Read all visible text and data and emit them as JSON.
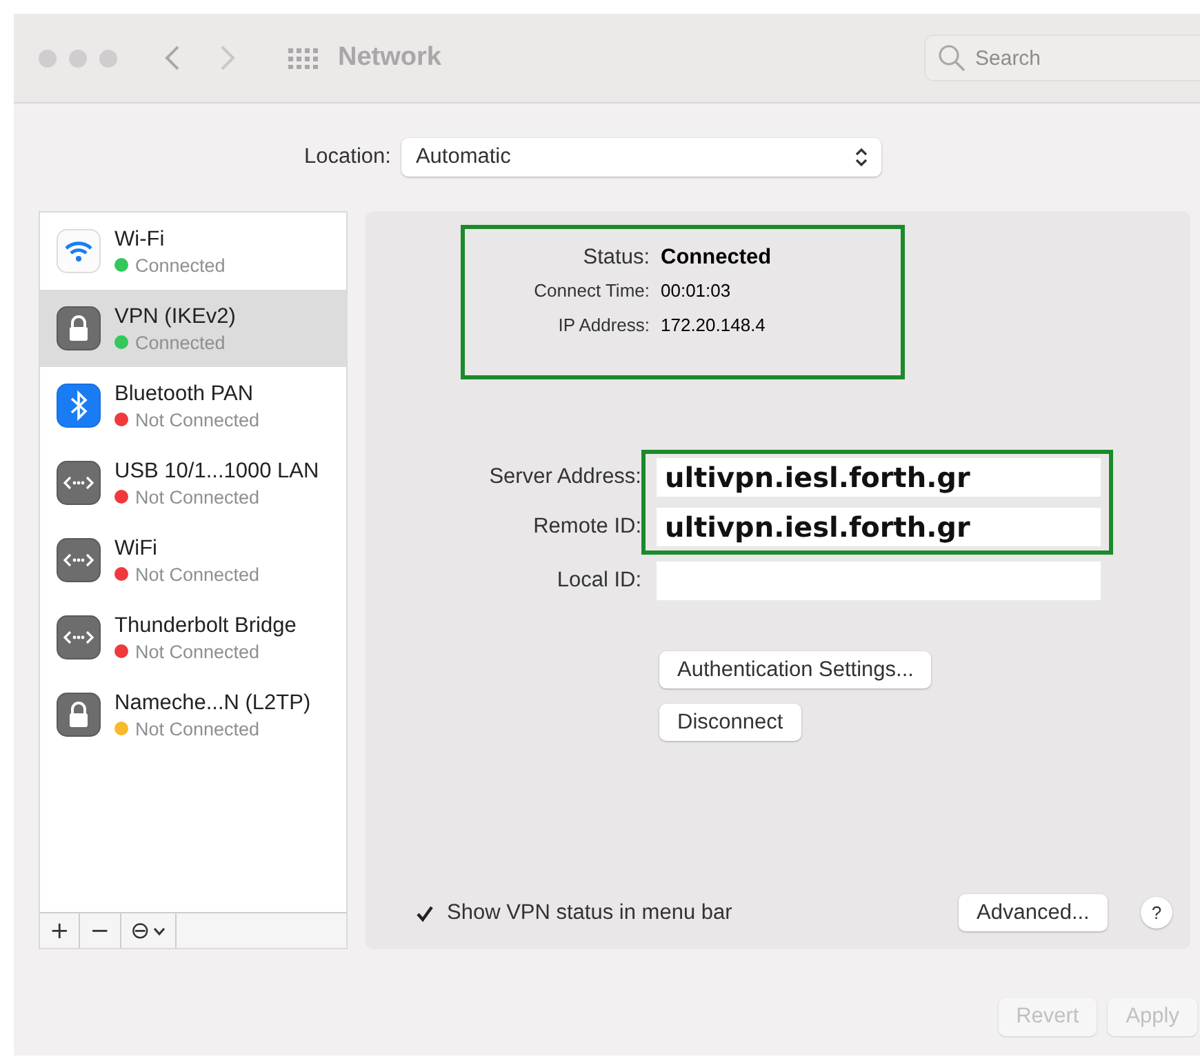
{
  "window": {
    "title": "Network"
  },
  "search": {
    "placeholder": "Search"
  },
  "location": {
    "label": "Location:",
    "value": "Automatic"
  },
  "services": [
    {
      "kind": "wifi",
      "name": "Wi-Fi",
      "status": "Connected",
      "color": "#34c759",
      "selected": false
    },
    {
      "kind": "lock",
      "name": "VPN (IKEv2)",
      "status": "Connected",
      "color": "#34c759",
      "selected": true
    },
    {
      "kind": "bluetooth",
      "name": "Bluetooth PAN",
      "status": "Not Connected",
      "color": "#f0393c",
      "selected": false
    },
    {
      "kind": "ethernet",
      "name": "USB 10/1...1000 LAN",
      "status": "Not Connected",
      "color": "#f0393c",
      "selected": false
    },
    {
      "kind": "ethernet",
      "name": "WiFi",
      "status": "Not Connected",
      "color": "#f0393c",
      "selected": false
    },
    {
      "kind": "ethernet",
      "name": "Thunderbolt Bridge",
      "status": "Not Connected",
      "color": "#f0393c",
      "selected": false
    },
    {
      "kind": "lock",
      "name": "Nameche...N (L2TP)",
      "status": "Not Connected",
      "color": "#f8b92a",
      "selected": false
    }
  ],
  "service_toolbar": [
    "+",
    "−",
    "⊖"
  ],
  "status_box": {
    "highlighted": true,
    "rows": [
      {
        "kind": "headline",
        "label": "Status:",
        "value": "Connected"
      },
      {
        "kind": "detail",
        "label": "Connect Time:",
        "value": "00:01:03"
      },
      {
        "kind": "detail",
        "label": "IP Address:",
        "value": "172.20.148.4"
      }
    ]
  },
  "fields": [
    {
      "label": "Server Address:",
      "value": "ultivpn.iesl.forth.gr",
      "highlighted": true
    },
    {
      "label": "Remote ID:",
      "value": "ultivpn.iesl.forth.gr",
      "highlighted": true
    },
    {
      "label": "Local ID:",
      "highlighted": false
    }
  ],
  "buttons": [
    "Authentication Settings...",
    "Disconnect"
  ],
  "show_status": {
    "label": "Show VPN status in menu bar",
    "checked": true
  },
  "advanced": "Advanced...",
  "help": "?",
  "footer_buttons": [
    {
      "label": "Revert",
      "disabled": true
    },
    {
      "label": "Apply",
      "disabled": true
    }
  ]
}
